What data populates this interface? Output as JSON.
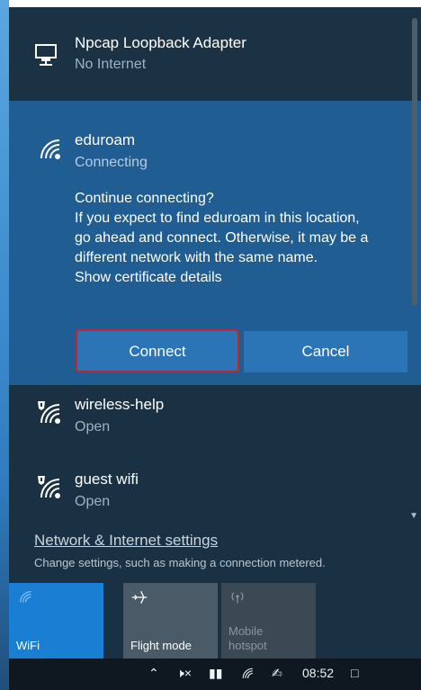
{
  "networks": {
    "adapter": {
      "name": "Npcap Loopback Adapter",
      "status": "No Internet",
      "icon": "ethernet-icon"
    },
    "eduroam": {
      "name": "eduroam",
      "status": "Connecting",
      "icon": "wifi-icon",
      "prompt_lines": [
        "Continue connecting?",
        "If you expect to find eduroam in this location,",
        "go ahead and connect. Otherwise, it may be a",
        "different network with the same name.",
        "Show certificate details"
      ],
      "connect_label": "Connect",
      "cancel_label": "Cancel"
    },
    "wireless_help": {
      "name": "wireless-help",
      "status": "Open",
      "icon": "wifi-warning-icon"
    },
    "guest_wifi": {
      "name": "guest wifi",
      "status": "Open",
      "icon": "wifi-warning-icon"
    }
  },
  "settings": {
    "link": "Network & Internet settings",
    "description": "Change settings, such as making a connection metered."
  },
  "quick_actions": [
    {
      "label": "WiFi",
      "icon": "wifi-icon",
      "state": "on"
    },
    {
      "label": "Flight mode",
      "icon": "airplane-icon",
      "state": "off"
    },
    {
      "label": "Mobile hotspot",
      "label_lines": [
        "Mobile",
        "hotspot"
      ],
      "icon": "hotspot-icon",
      "state": "disabled"
    }
  ],
  "taskbar": {
    "time": "08:52",
    "icons": [
      "chevron-up-icon",
      "volume-muted-icon",
      "battery-icon",
      "network-icon",
      "pen-icon",
      "notification-icon"
    ]
  },
  "colors": {
    "panel": "#1a3143",
    "selected": "#1f5d93",
    "button": "#2b74b5",
    "connect_border": "#c0272d",
    "wifi_tile": "#1a7fd3"
  }
}
